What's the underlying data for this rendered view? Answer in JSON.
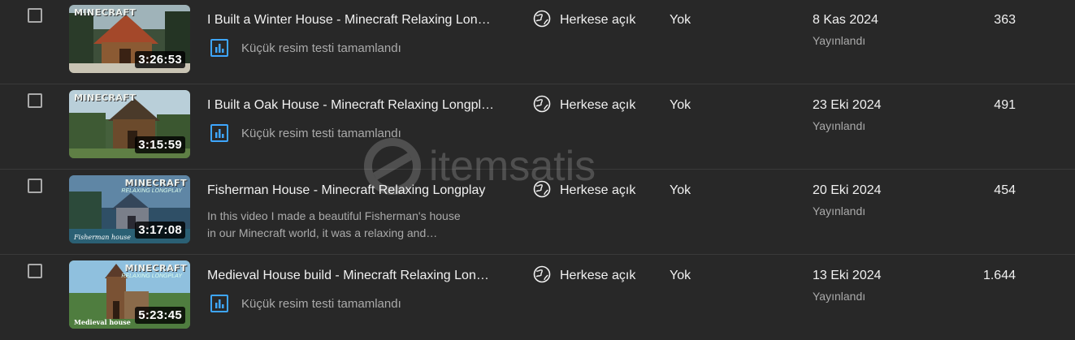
{
  "rows": [
    {
      "title": "I Built a Winter House - Minecraft Relaxing Lon…",
      "sub_text": "Küçük resim testi tamamlandı",
      "duration": "3:26:53",
      "visibility": "Herkese açık",
      "restrictions": "Yok",
      "date": "8 Kas 2024",
      "status": "Yayınlandı",
      "views": "363"
    },
    {
      "title": "I Built a Oak House - Minecraft Relaxing Longpl…",
      "sub_text": "Küçük resim testi tamamlandı",
      "duration": "3:15:59",
      "visibility": "Herkese açık",
      "restrictions": "Yok",
      "date": "23 Eki 2024",
      "status": "Yayınlandı",
      "views": "491"
    },
    {
      "title": "Fisherman House - Minecraft Relaxing Longplay",
      "description_line1": "In this video I made a beautiful Fisherman's house",
      "description_line2": "in our Minecraft world, it was a relaxing and…",
      "duration": "3:17:08",
      "thumb_caption": "Fisherman house",
      "visibility": "Herkese açık",
      "restrictions": "Yok",
      "date": "20 Eki 2024",
      "status": "Yayınlandı",
      "views": "454"
    },
    {
      "title": "Medieval House build - Minecraft Relaxing Lon…",
      "sub_text": "Küçük resim testi tamamlandı",
      "duration": "5:23:45",
      "thumb_caption": "Medieval house",
      "visibility": "Herkese açık",
      "restrictions": "Yok",
      "date": "13 Eki 2024",
      "status": "Yayınlandı",
      "views": "1.644"
    }
  ],
  "thumb_logo": "MINECRAFT",
  "thumb_logo_sub": "RELAXING LONGPLAY",
  "watermark": "itemsatis",
  "colors": {
    "background": "#282828",
    "divider": "#3a3a3a",
    "text_primary": "#f1f1f1",
    "text_secondary": "#aaaaaa",
    "analytics_icon": "#3ea6ff"
  },
  "icons": {
    "visibility": "globe-icon",
    "sub": "analytics-icon"
  }
}
